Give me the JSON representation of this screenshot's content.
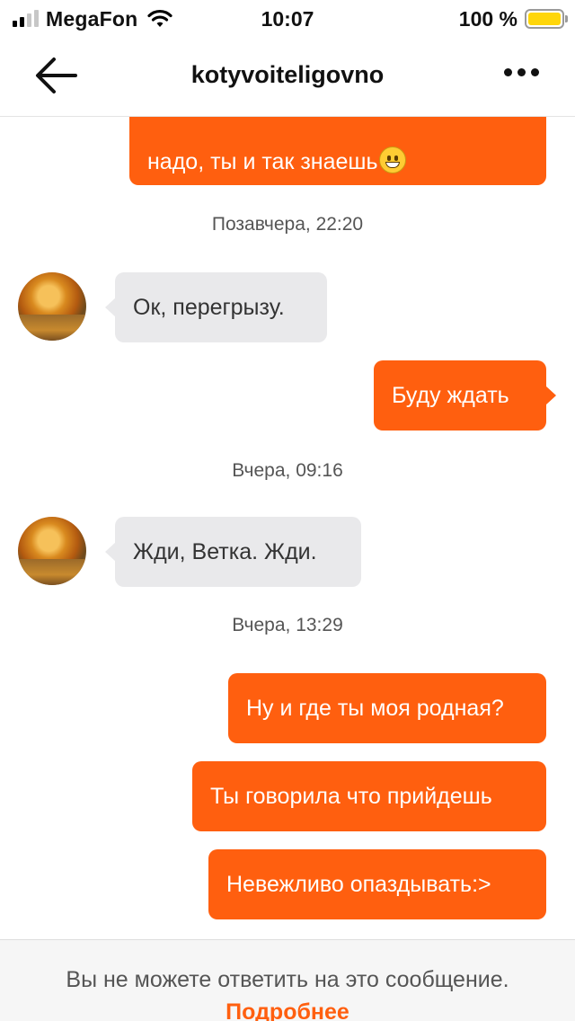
{
  "status_bar": {
    "carrier": "MegaFon",
    "time": "10:07",
    "battery_percent": "100 %",
    "battery_color": "#ffd60a",
    "signal_bars_active": 2,
    "signal_bars_total": 4,
    "icons": [
      "signal-icon",
      "wifi-icon",
      "battery-icon"
    ]
  },
  "header": {
    "title": "kotyvoiteligovno",
    "back_icon": "arrow-left-icon",
    "more_icon": "ellipsis-icon"
  },
  "chat": {
    "accent_color": "#ff5f0f",
    "incoming_color": "#e9e9eb",
    "partial_top_message": "надо, ты и так знаешь",
    "partial_top_emoji": "grinning-face-emoji",
    "timestamps": [
      "Позавчера, 22:20",
      "Вчера, 09:16",
      "Вчера, 13:29"
    ],
    "messages": [
      {
        "direction": "in",
        "text": "Ок, перегрызу."
      },
      {
        "direction": "out",
        "text": "Буду ждать"
      },
      {
        "direction": "in",
        "text": "Жди, Ветка. Жди."
      },
      {
        "direction": "out",
        "text": "Ну и где ты моя родная?"
      },
      {
        "direction": "out",
        "text": "Ты говорила что прийдешь"
      },
      {
        "direction": "out",
        "text": "Невежливо опаздывать:>"
      }
    ]
  },
  "footer": {
    "notice": "Вы не можете ответить на это сообщение.",
    "link": "Подробнее"
  }
}
